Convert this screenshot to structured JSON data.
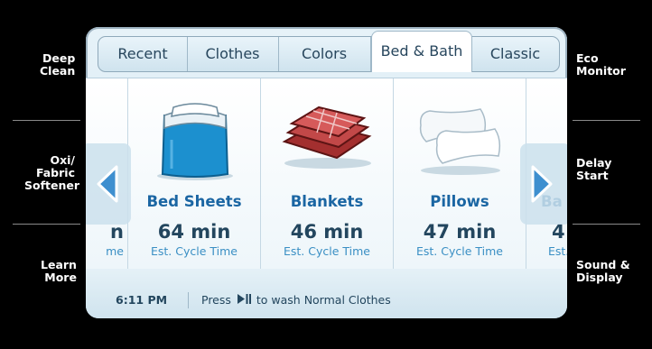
{
  "left_menu": [
    {
      "line1": "Deep",
      "line2": "Clean"
    },
    {
      "line1": "Oxi/",
      "line2": "Fabric",
      "line3": "Softener"
    },
    {
      "line1": "Learn",
      "line2": "More"
    }
  ],
  "right_menu": [
    {
      "line1": "Eco",
      "line2": "Monitor"
    },
    {
      "line1": "Delay",
      "line2": "Start"
    },
    {
      "line1": "Sound &",
      "line2": "Display"
    }
  ],
  "tabs": [
    "Recent",
    "Clothes",
    "Colors",
    "Bed & Bath",
    "Classic"
  ],
  "active_tab": "Bed & Bath",
  "cycles": [
    {
      "name": "",
      "time": "n",
      "sub": "me"
    },
    {
      "name": "Bed Sheets",
      "time": "64 min",
      "sub": "Est. Cycle Time"
    },
    {
      "name": "Blankets",
      "time": "46 min",
      "sub": "Est. Cycle Time"
    },
    {
      "name": "Pillows",
      "time": "47 min",
      "sub": "Est. Cycle Time"
    },
    {
      "name": "Ba",
      "time": "4",
      "sub": "Est."
    }
  ],
  "status": {
    "time": "6:11 PM",
    "message_before": "Press",
    "play_pause_icon": "play-pause-icon",
    "message_after": "to wash Normal Clothes"
  },
  "colors": {
    "accent": "#1b66a3",
    "text": "#23465e",
    "background": "#000000"
  }
}
